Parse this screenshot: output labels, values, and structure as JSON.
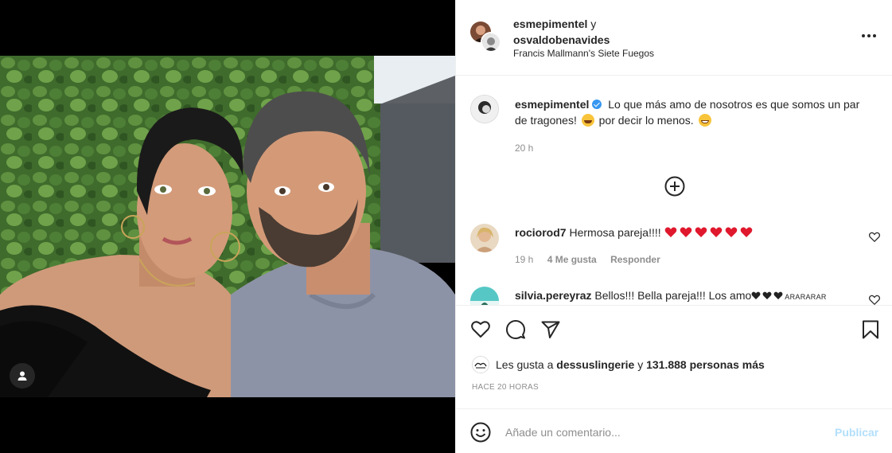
{
  "post": {
    "media": {
      "alt_icon": "user-tag-icon"
    },
    "header": {
      "user1": "esmepimentel",
      "conj": "y",
      "user2": "osvaldobenavides",
      "location": "Francis Mallmann's Siete Fuegos"
    },
    "caption": {
      "username": "esmepimentel",
      "text_part1": "Lo que más amo de nosotros es que somos un par de tragones!",
      "text_part2": "por decir lo menos.",
      "time": "20 h"
    },
    "comments": [
      {
        "username": "rociorod7",
        "text": "Hermosa pareja!!!!",
        "time": "19 h",
        "likes": "4 Me gusta",
        "reply": "Responder"
      },
      {
        "username": "silvia.pereyraz",
        "text": "Bellos!!! Bella pareja!!! Los amo",
        "suffix": "ARARARAR"
      }
    ],
    "likes": {
      "prefix": "Les gusta a",
      "user": "dessuslingerie",
      "conj": "y",
      "count": "131.888 personas más"
    },
    "ago": "HACE 20 HORAS",
    "add_comment": {
      "placeholder": "Añade un comentario...",
      "publish": "Publicar"
    },
    "colors": {
      "accent_blue": "#3897f0",
      "publish_disabled": "#b2dffc",
      "heart_red": "#ed4956"
    }
  }
}
